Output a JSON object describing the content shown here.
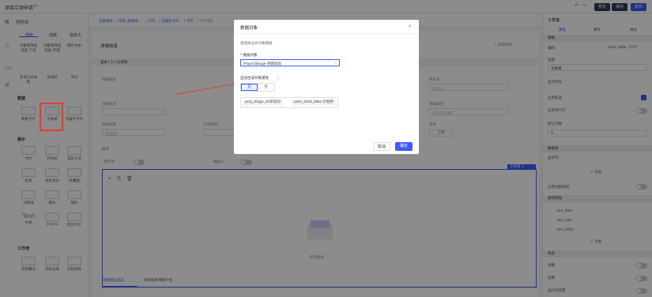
{
  "topbar": {
    "title": "项目立项申请",
    "btn_preview": "预览",
    "btn_save": "保存",
    "btn_publish": "发布"
  },
  "left_panel": {
    "title": "控件栏",
    "tabs": [
      {
        "label": "通用"
      },
      {
        "label": "动效"
      },
      {
        "label": "自定义"
      }
    ],
    "top_items": [
      {
        "label": "对象和筛选 筛选-下拉"
      },
      {
        "label": "对象和筛选 筛选-平铺"
      },
      {
        "label": "图片文本"
      },
      {
        "label": "多语言文本 框"
      },
      {
        "label": "自动码"
      },
      {
        "label": "评分"
      }
    ],
    "section_data": "数据",
    "data_items": [
      {
        "label": "数据卡片"
      },
      {
        "label": "子表格"
      },
      {
        "label": "可展开卡片"
      }
    ],
    "section_display": "展示",
    "display_items": [
      {
        "label": "卡片"
      },
      {
        "label": "行布局"
      },
      {
        "label": "自定义块"
      },
      {
        "label": "标签"
      },
      {
        "label": "多标签页"
      },
      {
        "label": "折叠面"
      },
      {
        "label": "分割线"
      },
      {
        "label": "图片"
      },
      {
        "label": "图标"
      },
      {
        "label": "文本"
      },
      {
        "label": "iFrame"
      },
      {
        "label": "跨页卡片"
      }
    ],
    "text_sample": "Text",
    "section_workflow": "工作流",
    "workflow_items": [
      {
        "label": "流程審注"
      },
      {
        "label": "流程记录"
      },
      {
        "label": "流程流程"
      }
    ]
  },
  "breadcrumb": {
    "items": [
      "全部组件",
      "/ 项目_新增项",
      "/ 卡片",
      "/ 可展开卡片",
      "/ 卡片",
      "/ 卡片内容"
    ]
  },
  "canvas": {
    "card_title": "详细信息",
    "card_action": "+ 新建项目",
    "section_title": "基本 / 1 / 分项目",
    "labels": {
      "project_code": "项目编号",
      "project_name": "项目名称",
      "approval_no": "审批号",
      "project_status": "项目状态",
      "project_level": "项目级别",
      "project_type": "项目分类",
      "approval_time": "立项时间",
      "desc": "描述",
      "attach": "附件",
      "is_key": "重点项",
      "fill_name": "填报人",
      "upload": "上传"
    },
    "placeholders": {
      "select": "请选择",
      "date": "请选择日期",
      "input": "请输入"
    },
    "subtable_tag": "子表格 1",
    "subtable_empty": "暂无数据",
    "bottom_tabs": [
      "项目团队成员",
      "项目成本预算计划"
    ]
  },
  "modal": {
    "title": "数据对象",
    "hint": "请选择业务对象数据",
    "obj_label": "* 数据对象",
    "obj_value": "ProjectStage-项目阶段",
    "auto_label": "自动生成对象属性",
    "seg_yes": "是",
    "seg_no": "否",
    "tags": [
      "proj_stage_id-阶段ID",
      "plan_start_date-计划开"
    ],
    "cancel": "取消",
    "ok": "确定"
  },
  "right_panel": {
    "title": "子表格",
    "tabs": [
      "属性",
      "事件",
      "样式"
    ],
    "base_head": "基础",
    "rows": [
      {
        "label": "编码",
        "value": "data_table_TYVY"
      },
      {
        "label": "标题",
        "value": ""
      },
      {
        "label": "",
        "value": "子表格"
      },
      {
        "label": "显示序号",
        "value": ""
      },
      {
        "label": "启用多选",
        "value": ""
      },
      {
        "label": "启用单行行",
        "value": ""
      },
      {
        "label": "默认行数",
        "value": "0"
      }
    ],
    "data_head": "数据源",
    "field_list": "显示列",
    "add": "+ 添加",
    "top_buttons": "启用顶部按钮",
    "op_head": "操作按钮",
    "ops": [
      "btn_flow",
      "btn_add",
      "btn_0002"
    ],
    "state_head": "状态",
    "states": [
      {
        "label": "隐藏"
      },
      {
        "label": "禁用"
      },
      {
        "label": "运行时禁用"
      }
    ]
  },
  "colors": {
    "accent": "#3d5afe",
    "annotation": "#e53935"
  }
}
